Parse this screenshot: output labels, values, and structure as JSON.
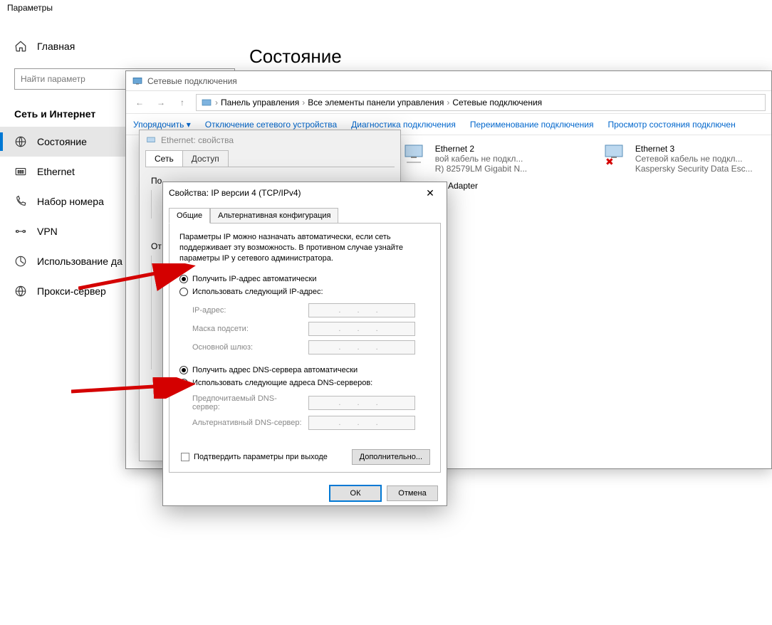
{
  "settings": {
    "title": "Параметры",
    "home": "Главная",
    "search_placeholder": "Найти параметр",
    "section": "Сеть и Интернет",
    "nav": {
      "status": "Состояние",
      "ethernet": "Ethernet",
      "dialup": "Набор номера",
      "vpn": "VPN",
      "usage": "Использование да",
      "proxy": "Прокси-сервер"
    },
    "page_title": "Состояние"
  },
  "cp": {
    "title": "Сетевые подключения",
    "breadcrumb": {
      "a": "Панель управления",
      "b": "Все элементы панели управления",
      "c": "Сетевые подключения"
    },
    "toolbar": {
      "org": "Упорядочить ▾",
      "disable": "Отключение сетевого устройства",
      "diag": "Диагностика подключения",
      "rename": "Переименование подключения",
      "view": "Просмотр состояния подключен"
    },
    "adapters": {
      "eth2": {
        "name": "Ethernet 2",
        "status": "вой кабель не подкл...",
        "dev": "R) 82579LM Gigabit N..."
      },
      "eth3": {
        "name": "Ethernet 3",
        "status": "Сетевой кабель не подкл...",
        "dev": "Kaspersky Security Data Esc..."
      },
      "wan": {
        "name": "Adapter"
      }
    }
  },
  "eth": {
    "title": "Ethernet: свойства",
    "tabs": {
      "net": "Сеть",
      "access": "Доступ"
    },
    "connect_label": "По",
    "desc_label": "От"
  },
  "ipv4": {
    "title": "Свойства: IP версии 4 (TCP/IPv4)",
    "tabs": {
      "general": "Общие",
      "alt": "Альтернативная конфигурация"
    },
    "intro": "Параметры IP можно назначать автоматически, если сеть поддерживает эту возможность. В противном случае узнайте параметры IP у сетевого администратора.",
    "ip_auto": "Получить IP-адрес автоматически",
    "ip_manual": "Использовать следующий IP-адрес:",
    "ip_addr": "IP-адрес:",
    "mask": "Маска подсети:",
    "gateway": "Основной шлюз:",
    "dns_auto": "Получить адрес DNS-сервера автоматически",
    "dns_manual": "Использовать следующие адреса DNS-серверов:",
    "dns_pref": "Предпочитаемый DNS-сервер:",
    "dns_alt": "Альтернативный DNS-сервер:",
    "confirm": "Подтвердить параметры при выходе",
    "advanced": "Дополнительно...",
    "ok": "ОК",
    "cancel": "Отмена",
    "dots": ".   .   ."
  }
}
